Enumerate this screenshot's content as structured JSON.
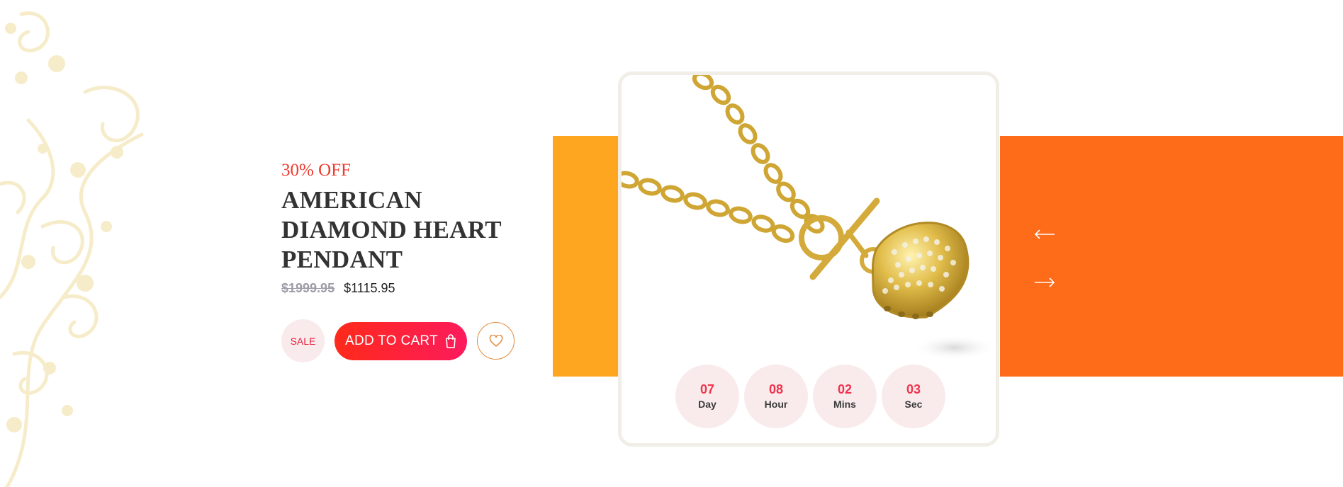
{
  "offer": {
    "discount_text": "30% OFF"
  },
  "product": {
    "title_lines": [
      "AMERICAN",
      "DIAMOND HEART",
      "PENDANT"
    ],
    "old_price": "$1999.95",
    "new_price": "$1115.95",
    "image_icon": "heart-pendant-necklace"
  },
  "actions": {
    "sale_label": "SALE",
    "add_to_cart_label": "ADD TO CART",
    "cart_icon": "shopping-bag-icon",
    "wishlist_icon": "heart-icon"
  },
  "countdown": [
    {
      "value": "07",
      "label": "Day"
    },
    {
      "value": "08",
      "label": "Hour"
    },
    {
      "value": "02",
      "label": "Mins"
    },
    {
      "value": "03",
      "label": "Sec"
    }
  ],
  "slider": {
    "prev_icon": "arrow-left-icon",
    "next_icon": "arrow-right-icon"
  },
  "colors": {
    "accent_orange": "#fe6b19",
    "accent_amber": "#fea620",
    "cart_gradient_start": "#fe2a1a",
    "cart_gradient_end": "#fd1b5c",
    "discount_red": "#ee3a2f"
  }
}
